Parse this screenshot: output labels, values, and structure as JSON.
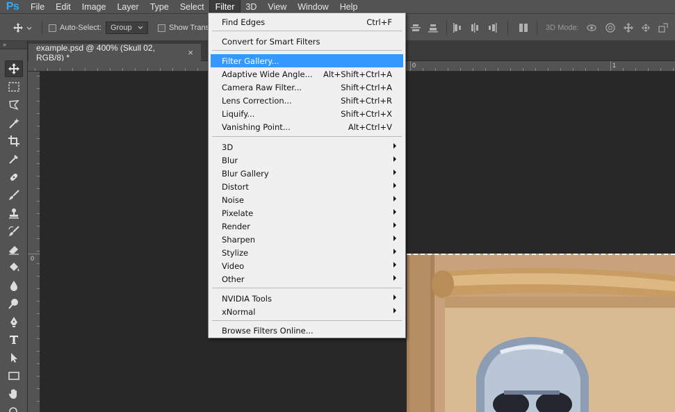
{
  "app": {
    "logo": "Ps"
  },
  "menubar": {
    "items": [
      "File",
      "Edit",
      "Image",
      "Layer",
      "Type",
      "Select",
      "Filter",
      "3D",
      "View",
      "Window",
      "Help"
    ],
    "active": "Filter"
  },
  "options_bar": {
    "auto_select_label": "Auto-Select:",
    "auto_select_value": "Group",
    "show_transform_label": "Show Transf",
    "mode_label": "3D Mode:"
  },
  "document_tab": {
    "title": "example.psd @ 400% (Skull 02, RGB/8) *",
    "close_glyph": "×"
  },
  "rulers": {
    "top_labels": [
      "0",
      "1"
    ],
    "left_labels": [
      "0"
    ]
  },
  "filter_menu": {
    "group1": [
      {
        "label": "Find Edges",
        "shortcut": "Ctrl+F"
      }
    ],
    "group2": [
      {
        "label": "Convert for Smart Filters",
        "shortcut": ""
      }
    ],
    "group3": [
      {
        "label": "Filter Gallery...",
        "shortcut": "",
        "highlighted": true
      },
      {
        "label": "Adaptive Wide Angle...",
        "shortcut": "Alt+Shift+Ctrl+A"
      },
      {
        "label": "Camera Raw Filter...",
        "shortcut": "Shift+Ctrl+A"
      },
      {
        "label": "Lens Correction...",
        "shortcut": "Shift+Ctrl+R"
      },
      {
        "label": "Liquify...",
        "shortcut": "Shift+Ctrl+X"
      },
      {
        "label": "Vanishing Point...",
        "shortcut": "Alt+Ctrl+V"
      }
    ],
    "group4": [
      "3D",
      "Blur",
      "Blur Gallery",
      "Distort",
      "Noise",
      "Pixelate",
      "Render",
      "Sharpen",
      "Stylize",
      "Video",
      "Other"
    ],
    "group5": [
      "NVIDIA Tools",
      "xNormal"
    ],
    "group6": [
      {
        "label": "Browse Filters Online...",
        "shortcut": ""
      }
    ]
  },
  "tools": [
    "move-tool",
    "marquee-tool",
    "lasso-tool",
    "magic-wand-tool",
    "crop-tool",
    "eyedropper-tool",
    "healing-brush-tool",
    "brush-tool",
    "clone-stamp-tool",
    "history-brush-tool",
    "eraser-tool",
    "paint-bucket-tool",
    "blur-tool",
    "dodge-tool",
    "pen-tool",
    "type-tool",
    "path-selection-tool",
    "rectangle-tool",
    "hand-tool",
    "zoom-tool"
  ],
  "colors": {
    "menu_highlight": "#3399ff",
    "accent_logo": "#31a8ff",
    "panel_bg": "#535353",
    "canvas_bg": "#282828"
  }
}
